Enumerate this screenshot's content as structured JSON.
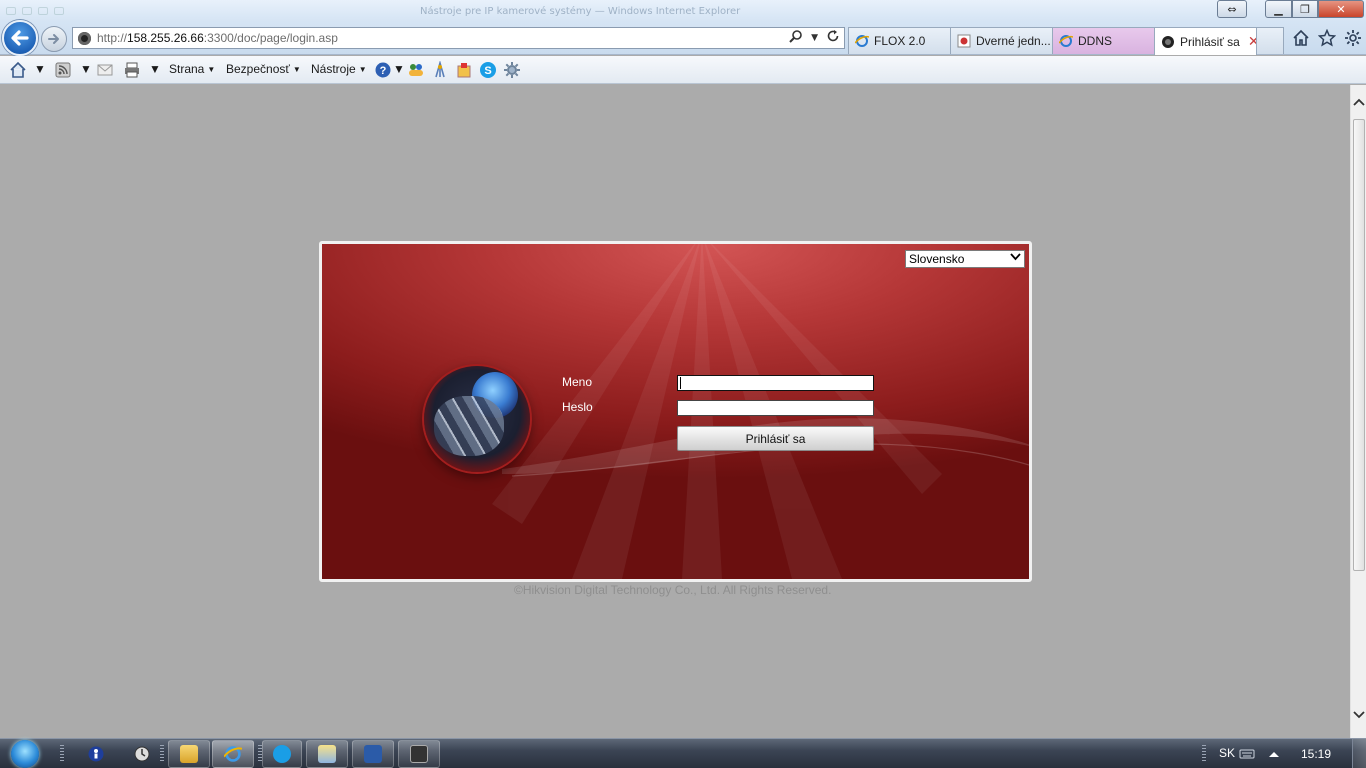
{
  "window": {
    "ghost_title": "Nástroje pre IP kamerové systémy — Windows Internet Explorer",
    "controls": {
      "minimize": "▁",
      "maximize": "❐",
      "close": "✕",
      "restore_alt": "⇔"
    }
  },
  "address_bar": {
    "url_prefix": "http://",
    "url_host": "158.255.26.66",
    "url_rest": ":3300/doc/page/login.asp",
    "search_icon": "search-icon",
    "refresh_icon": "refresh-icon"
  },
  "tabs": [
    {
      "label": "FLOX 2.0",
      "icon": "ie-icon"
    },
    {
      "label": "Dverné jedn...",
      "icon": "page-icon"
    },
    {
      "label": "DDNS",
      "icon": "ie-icon"
    },
    {
      "label": "Prihlásiť sa",
      "icon": "camera-icon",
      "active": true,
      "close": "✕"
    }
  ],
  "right_icons": [
    "home-icon",
    "star-icon",
    "gear-icon"
  ],
  "command_bar": {
    "page": "Strana",
    "safety": "Bezpečnosť",
    "tools": "Nástroje"
  },
  "login": {
    "language": "Slovensko",
    "username_label": "Meno",
    "password_label": "Heslo",
    "username_value": "",
    "password_value": "",
    "login_button": "Prihlásiť sa"
  },
  "footer": {
    "copyright": "©Hikvision Digital Technology Co., Ltd. All Rights Reserved."
  },
  "taskbar": {
    "language": "SK",
    "clock": "15:19"
  },
  "colors": {
    "panel_red": "#b53737",
    "panel_dark": "#6a0f0f",
    "page_bg": "#ababab",
    "ie_blue": "#1f63b8"
  }
}
